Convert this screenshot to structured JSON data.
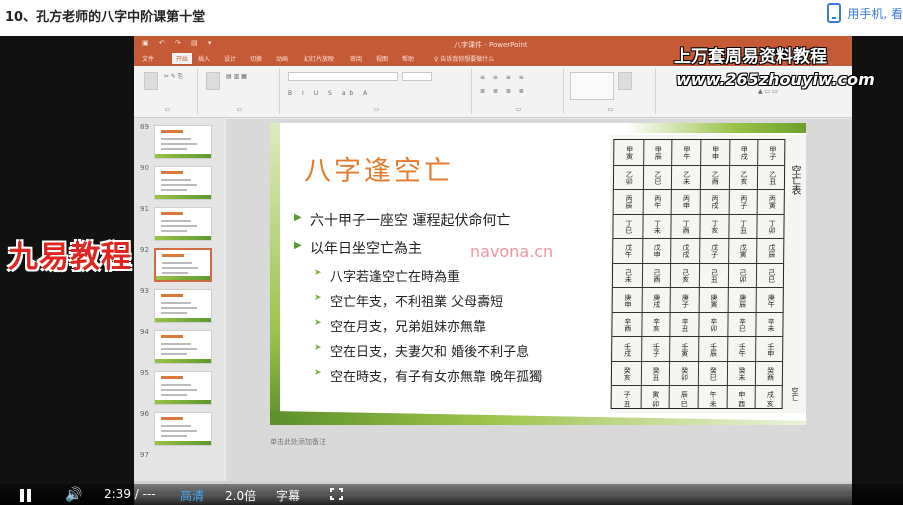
{
  "page": {
    "title": "10、孔方老师的八字中阶课第十堂",
    "phone_link": "用手机, 看"
  },
  "ppt": {
    "window_title": "八字课件 - PowerPoint",
    "tabs": [
      "文件",
      "开始",
      "插入",
      "设计",
      "切换",
      "动画",
      "幻灯片放映",
      "审阅",
      "视图",
      "帮助",
      "♀ 告诉我你想要做什么"
    ],
    "thumb_numbers": [
      "89",
      "90",
      "91",
      "92",
      "93",
      "94",
      "95",
      "96",
      "97"
    ],
    "notes_placeholder": "单击此处添加备注"
  },
  "slide": {
    "title": "八字逢空亡",
    "bullets": [
      {
        "level": 1,
        "text": "六十甲子一座空 運程起伏命何亡"
      },
      {
        "level": 1,
        "text": "以年日坐空亡為主"
      },
      {
        "level": 2,
        "text": "八字若逢空亡在時為重"
      },
      {
        "level": 2,
        "text": "空亡年支，不利祖業 父母壽短"
      },
      {
        "level": 2,
        "text": "空在月支，兄弟姐妹亦無靠"
      },
      {
        "level": 2,
        "text": "空在日支，夫妻欠和 婚後不利子息"
      },
      {
        "level": 2,
        "text": "空在時支，有子有女亦無靠 晚年孤獨"
      }
    ]
  },
  "table": {
    "side_label": "空亡表",
    "bottom_label": "空亡",
    "columns": [
      [
        "甲子",
        "乙丑",
        "丙寅",
        "丁卯",
        "戊辰",
        "己巳",
        "庚午",
        "辛未",
        "壬申",
        "癸酉",
        "戌·亥"
      ],
      [
        "甲戌",
        "乙亥",
        "丙子",
        "丁丑",
        "戊寅",
        "己卯",
        "庚辰",
        "辛巳",
        "壬午",
        "癸未",
        "申·酉"
      ],
      [
        "甲申",
        "乙酉",
        "丙戌",
        "丁亥",
        "戊子",
        "己丑",
        "庚寅",
        "辛卯",
        "壬辰",
        "癸巳",
        "午·未"
      ],
      [
        "甲午",
        "乙未",
        "丙申",
        "丁酉",
        "戊戌",
        "己亥",
        "庚子",
        "辛丑",
        "壬寅",
        "癸卯",
        "辰·巳"
      ],
      [
        "甲辰",
        "乙巳",
        "丙午",
        "丁未",
        "戊申",
        "己酉",
        "庚戌",
        "辛亥",
        "壬子",
        "癸丑",
        "寅·卯"
      ],
      [
        "甲寅",
        "乙卯",
        "丙辰",
        "丁巳",
        "戊午",
        "己未",
        "庚申",
        "辛酉",
        "壬戌",
        "癸亥",
        "子·丑"
      ]
    ]
  },
  "watermarks": {
    "top": "上万套周易资料教程",
    "url": "www.265zhouyiw.com",
    "left": "九易教程",
    "center": "navona.cn"
  },
  "player": {
    "time": "2:39 / ---",
    "quality": "高清",
    "speed": "2.0倍",
    "subtitle": "字幕",
    "accent_color": "#3fa9f5"
  }
}
